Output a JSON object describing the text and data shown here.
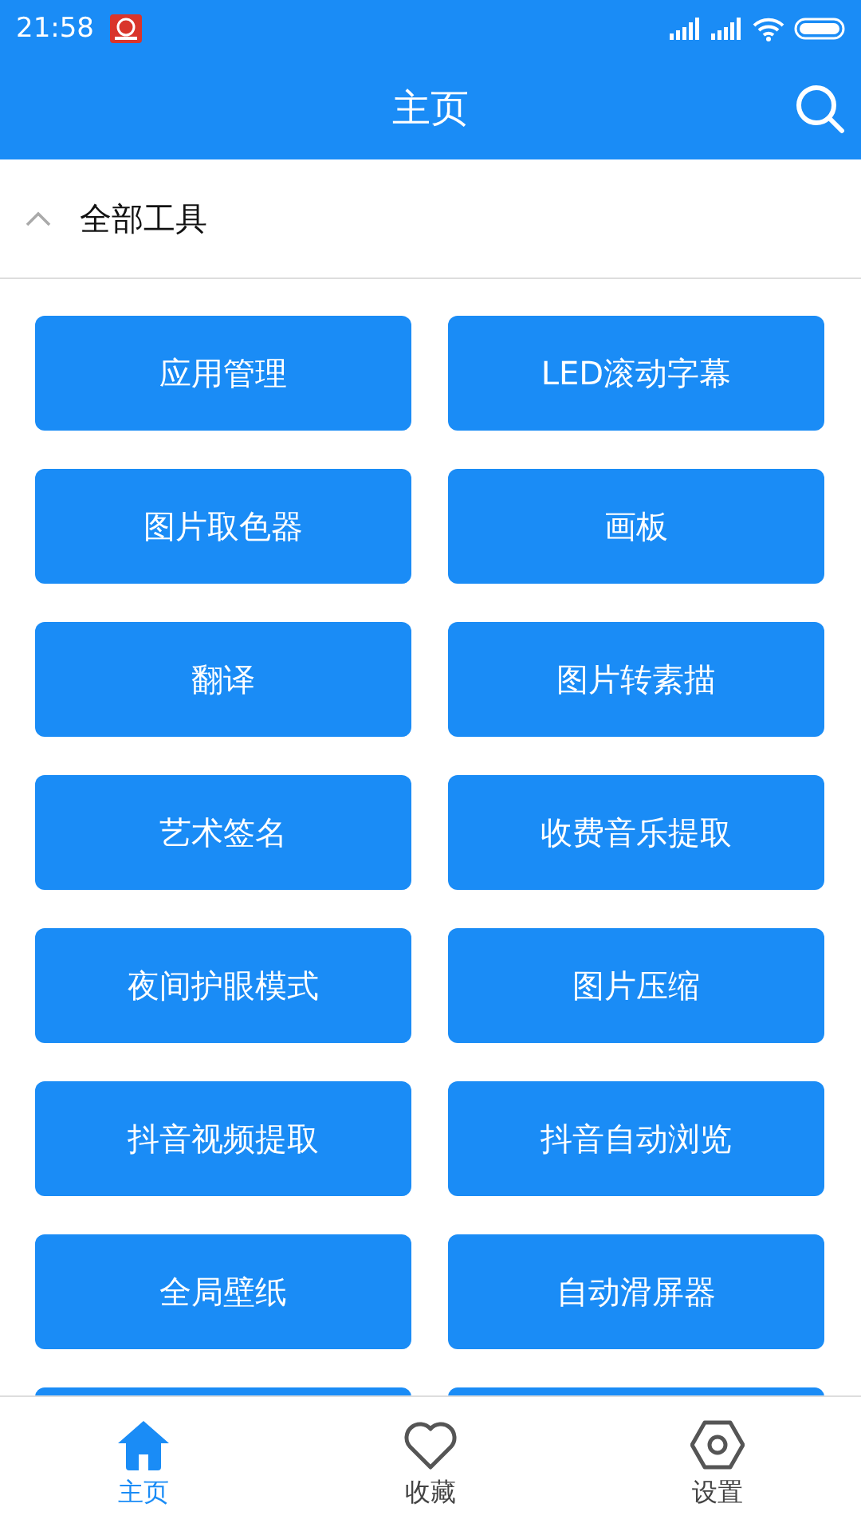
{
  "status_bar": {
    "time": "21:58"
  },
  "header": {
    "title": "主页"
  },
  "section": {
    "title": "全部工具",
    "expanded": true
  },
  "tools": [
    {
      "kind": "tool",
      "label": "应用管理"
    },
    {
      "kind": "tool",
      "label": "LED滚动字幕"
    },
    {
      "kind": "tool",
      "label": "图片取色器"
    },
    {
      "kind": "tool",
      "label": "画板"
    },
    {
      "kind": "tool",
      "label": "翻译"
    },
    {
      "kind": "tool",
      "label": "图片转素描"
    },
    {
      "kind": "tool",
      "label": "艺术签名"
    },
    {
      "kind": "tool",
      "label": "收费音乐提取"
    },
    {
      "kind": "tool",
      "label": "夜间护眼模式"
    },
    {
      "kind": "tool",
      "label": "图片压缩"
    },
    {
      "kind": "tool",
      "label": "抖音视频提取"
    },
    {
      "kind": "tool",
      "label": "抖音自动浏览"
    },
    {
      "kind": "tool",
      "label": "全局壁纸"
    },
    {
      "kind": "tool",
      "label": "自动滑屏器"
    },
    {
      "kind": "partial"
    },
    {
      "kind": "partial"
    }
  ],
  "bottom_nav": [
    {
      "kind": "home",
      "label": "主页",
      "selected": true
    },
    {
      "kind": "favorites",
      "label": "收藏",
      "selected": false
    },
    {
      "kind": "settings",
      "label": "设置",
      "selected": false
    }
  ]
}
